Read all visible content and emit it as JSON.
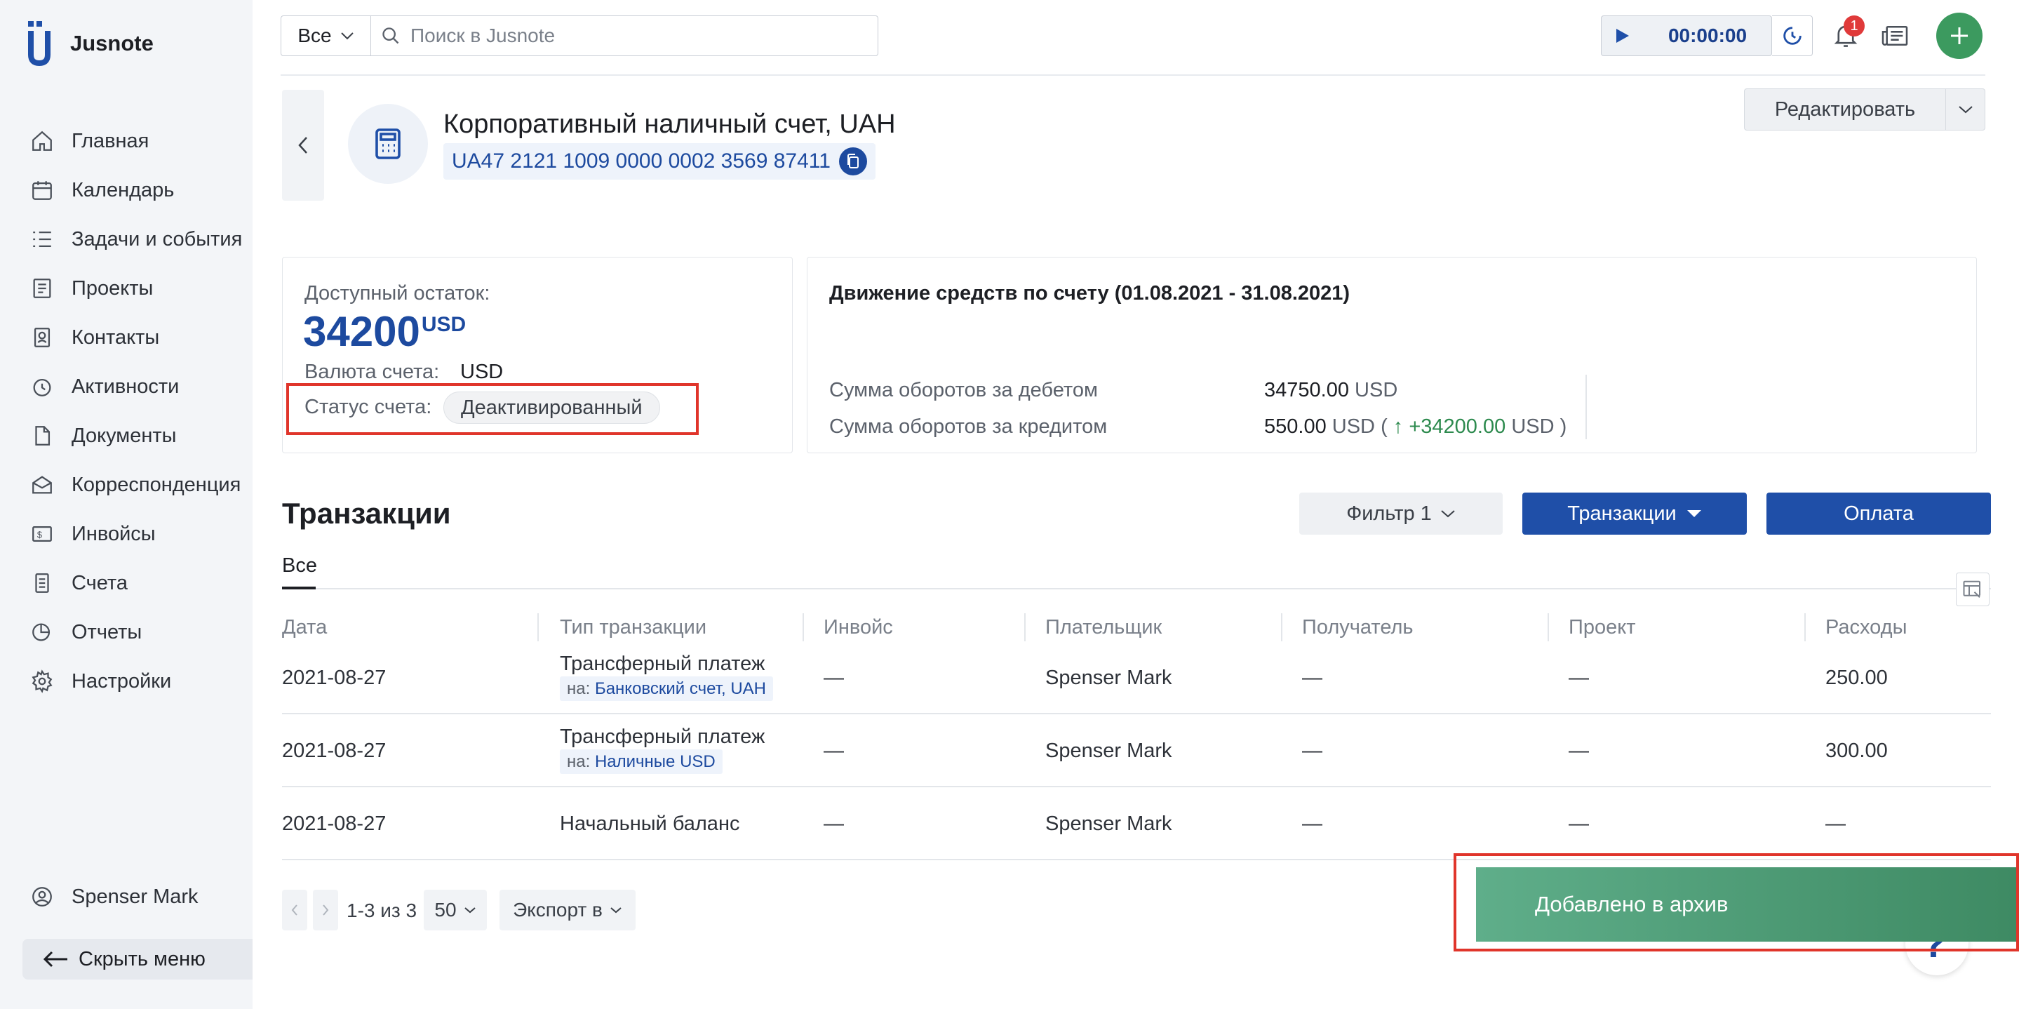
{
  "app": {
    "name": "Jusnote"
  },
  "sidebar": {
    "items": [
      {
        "label": "Главная",
        "icon": "home-icon"
      },
      {
        "label": "Календарь",
        "icon": "calendar-icon"
      },
      {
        "label": "Задачи и события",
        "icon": "tasks-icon"
      },
      {
        "label": "Проекты",
        "icon": "projects-icon"
      },
      {
        "label": "Контакты",
        "icon": "contacts-icon"
      },
      {
        "label": "Активности",
        "icon": "activity-icon"
      },
      {
        "label": "Документы",
        "icon": "documents-icon"
      },
      {
        "label": "Корреспонденция",
        "icon": "mail-icon"
      },
      {
        "label": "Инвойсы",
        "icon": "invoice-icon"
      },
      {
        "label": "Счета",
        "icon": "accounts-icon"
      },
      {
        "label": "Отчеты",
        "icon": "reports-icon"
      },
      {
        "label": "Настройки",
        "icon": "gear-icon"
      }
    ],
    "user": "Spenser Mark",
    "hide_menu": "Скрыть меню"
  },
  "topbar": {
    "scope": "Все",
    "search_placeholder": "Поиск в Jusnote",
    "timer": "00:00:00",
    "notifications_count": "1"
  },
  "account": {
    "title": "Корпоративный наличный счет, UAH",
    "iban": "UA47 2121 1009 0000 0002 3569 87411",
    "edit_label": "Редактировать"
  },
  "balance": {
    "available_label": "Доступный остаток:",
    "amount": "34200",
    "amount_currency": "USD",
    "currency_label": "Валюта счета:",
    "currency_value": "USD",
    "status_label": "Статус счета:",
    "status_value": "Деактивированный"
  },
  "flow": {
    "title": "Движение средств по счету (01.08.2021 - 31.08.2021)",
    "debit_label": "Сумма оборотов за дебетом",
    "debit_value": "34750.00",
    "debit_currency": "USD",
    "credit_label": "Сумма оборотов за кредитом",
    "credit_value": "550.00",
    "credit_currency": "USD",
    "credit_diff_open": "(",
    "credit_diff": "+34200.00",
    "credit_diff_currency": "USD",
    "credit_diff_close": ")"
  },
  "transactions": {
    "title": "Транзакции",
    "filter_label": "Фильтр 1",
    "tx_button": "Транзакции",
    "pay_button": "Оплата",
    "tab_all": "Все",
    "columns": [
      "Дата",
      "Тип транзакции",
      "Инвойс",
      "Плательщик",
      "Получатель",
      "Проект",
      "Расходы"
    ],
    "rows": [
      {
        "date": "2021-08-27",
        "type": "Трансферный платеж",
        "sub_prefix": "на:",
        "sub_target": "Банковский счет, UAH",
        "invoice": "—",
        "payer": "Spenser Mark",
        "recipient": "—",
        "project": "—",
        "expense": "250.00"
      },
      {
        "date": "2021-08-27",
        "type": "Трансферный платеж",
        "sub_prefix": "на:",
        "sub_target": "Наличные USD",
        "invoice": "—",
        "payer": "Spenser Mark",
        "recipient": "—",
        "project": "—",
        "expense": "300.00"
      },
      {
        "date": "2021-08-27",
        "type": "Начальный баланс",
        "sub_prefix": "",
        "sub_target": "",
        "invoice": "—",
        "payer": "Spenser Mark",
        "recipient": "—",
        "project": "—",
        "expense": "—"
      }
    ]
  },
  "pagination": {
    "range": "1-3 из 3",
    "per_page": "50",
    "export": "Экспорт в"
  },
  "toast": {
    "message": "Добавлено в архив"
  },
  "help": {
    "label": "?"
  },
  "colors": {
    "brand_blue": "#1f4fa8",
    "success_green": "#3c9a5f",
    "highlight_red": "#e0352b"
  }
}
